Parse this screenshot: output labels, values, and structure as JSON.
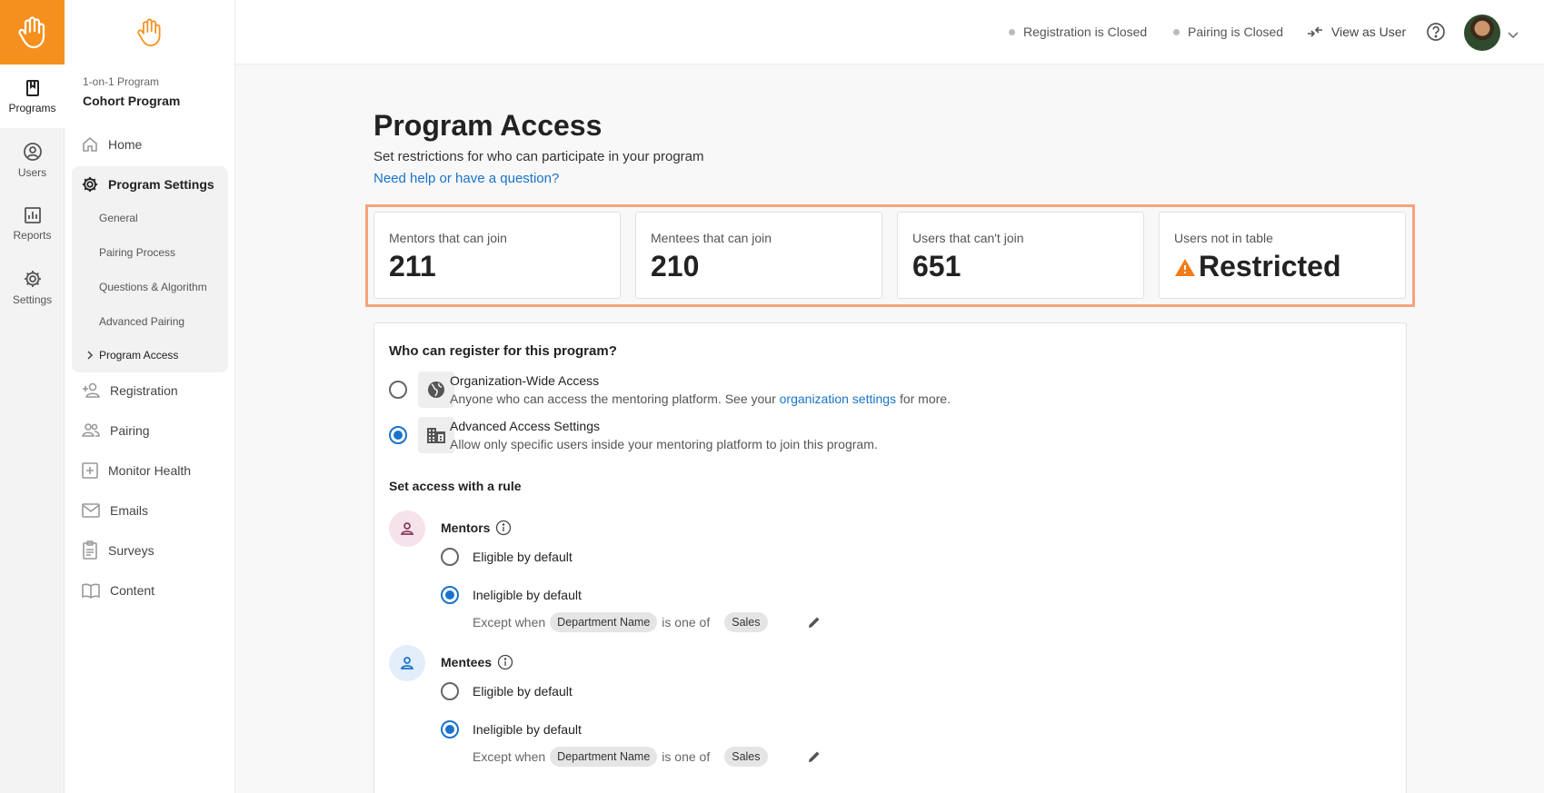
{
  "rail": {
    "items": [
      {
        "label": "Programs"
      },
      {
        "label": "Users"
      },
      {
        "label": "Reports"
      },
      {
        "label": "Settings"
      }
    ]
  },
  "sidebar": {
    "program_type": "1-on-1 Program",
    "program_name": "Cohort Program",
    "home": "Home",
    "program_settings": "Program Settings",
    "sub_items": [
      "General",
      "Pairing Process",
      "Questions & Algorithm",
      "Advanced Pairing",
      "Program Access"
    ],
    "items_after": [
      "Registration",
      "Pairing",
      "Monitor Health",
      "Emails",
      "Surveys",
      "Content"
    ]
  },
  "topbar": {
    "registration_status": "Registration is Closed",
    "pairing_status": "Pairing is Closed",
    "view_as_user": "View as User"
  },
  "page": {
    "title": "Program Access",
    "subtitle": "Set restrictions for who can participate in your program",
    "help_link": "Need help or have a question?"
  },
  "stats": [
    {
      "label": "Mentors that can join",
      "value": "211"
    },
    {
      "label": "Mentees that can join",
      "value": "210"
    },
    {
      "label": "Users that can't join",
      "value": "651"
    },
    {
      "label": "Users not in table",
      "value": "Restricted"
    }
  ],
  "registration": {
    "question": "Who can register for this program?",
    "org_wide_title": "Organization-Wide Access",
    "org_wide_desc_pre": "Anyone who can access the mentoring platform. See your",
    "org_wide_link": "organization settings",
    "org_wide_desc_post": "for more.",
    "advanced_title": "Advanced Access Settings",
    "advanced_desc": "Allow only specific users inside your mentoring platform to join this program.",
    "selected": "advanced"
  },
  "rules": {
    "heading": "Set access with a rule",
    "mentors": {
      "name": "Mentors",
      "eligible": "Eligible by default",
      "ineligible": "Ineligible by default",
      "except_when": "Except when",
      "field": "Department Name",
      "operator": "is one of",
      "value": "Sales",
      "selected": "ineligible"
    },
    "mentees": {
      "name": "Mentees",
      "eligible": "Eligible by default",
      "ineligible": "Ineligible by default",
      "except_when": "Except when",
      "field": "Department Name",
      "operator": "is one of",
      "value": "Sales",
      "selected": "ineligible"
    }
  },
  "colors": {
    "brand_orange": "#f5901f",
    "highlight": "#f5a37f",
    "link_blue": "#1a73c9",
    "warning": "#ef7d1a",
    "mentor_bg": "#f6e2ea",
    "mentee_bg": "#e3eefa"
  }
}
